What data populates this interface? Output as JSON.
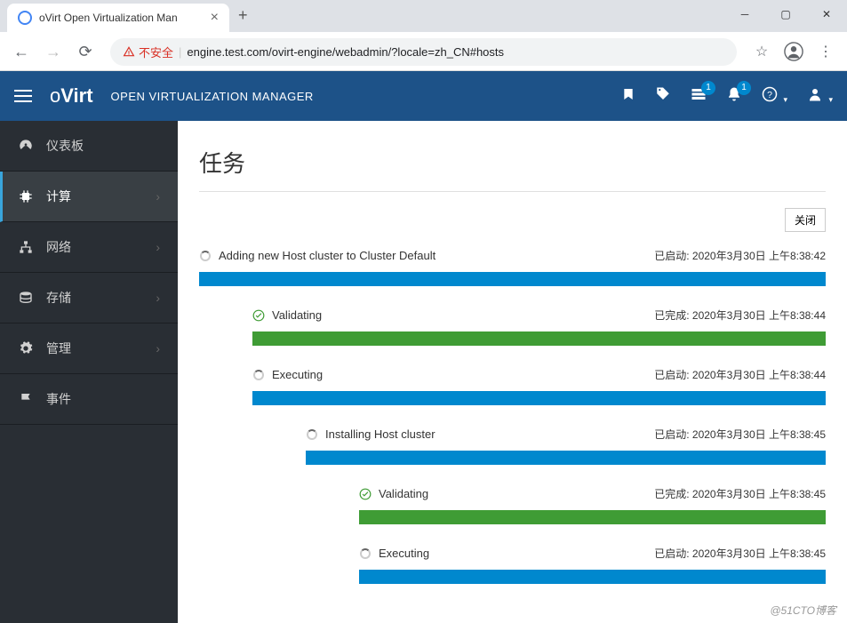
{
  "browser": {
    "tab_title": "oVirt Open Virtualization Man",
    "security_label": "不安全",
    "url": "engine.test.com/ovirt-engine/webadmin/?locale=zh_CN#hosts"
  },
  "header": {
    "logo": "oVirt",
    "subtitle": "OPEN VIRTUALIZATION MANAGER",
    "badge_tasks": "1",
    "badge_alerts": "1"
  },
  "sidebar": {
    "items": [
      {
        "label": "仪表板",
        "icon": "dashboard",
        "has_chevron": false,
        "active": false
      },
      {
        "label": "计算",
        "icon": "compute",
        "has_chevron": true,
        "active": true
      },
      {
        "label": "网络",
        "icon": "network",
        "has_chevron": true,
        "active": false
      },
      {
        "label": "存储",
        "icon": "storage",
        "has_chevron": true,
        "active": false
      },
      {
        "label": "管理",
        "icon": "admin",
        "has_chevron": true,
        "active": false
      },
      {
        "label": "事件",
        "icon": "events",
        "has_chevron": false,
        "active": false
      }
    ]
  },
  "main": {
    "page_title": "任务",
    "close_button": "关闭",
    "tasks": [
      {
        "indent": 0,
        "status": "running",
        "name": "Adding new Host cluster to Cluster Default",
        "time_label": "已启动: 2020年3月30日 上午8:38:42",
        "bar": "blue"
      },
      {
        "indent": 1,
        "status": "done",
        "name": "Validating",
        "time_label": "已完成: 2020年3月30日 上午8:38:44",
        "bar": "green"
      },
      {
        "indent": 1,
        "status": "running",
        "name": "Executing",
        "time_label": "已启动: 2020年3月30日 上午8:38:44",
        "bar": "blue"
      },
      {
        "indent": 2,
        "status": "running",
        "name": "Installing Host cluster",
        "time_label": "已启动: 2020年3月30日 上午8:38:45",
        "bar": "blue"
      },
      {
        "indent": 3,
        "status": "done",
        "name": "Validating",
        "time_label": "已完成: 2020年3月30日 上午8:38:45",
        "bar": "green"
      },
      {
        "indent": 3,
        "status": "running",
        "name": "Executing",
        "time_label": "已启动: 2020年3月30日 上午8:38:45",
        "bar": "blue"
      }
    ]
  },
  "watermark": "@51CTO博客"
}
